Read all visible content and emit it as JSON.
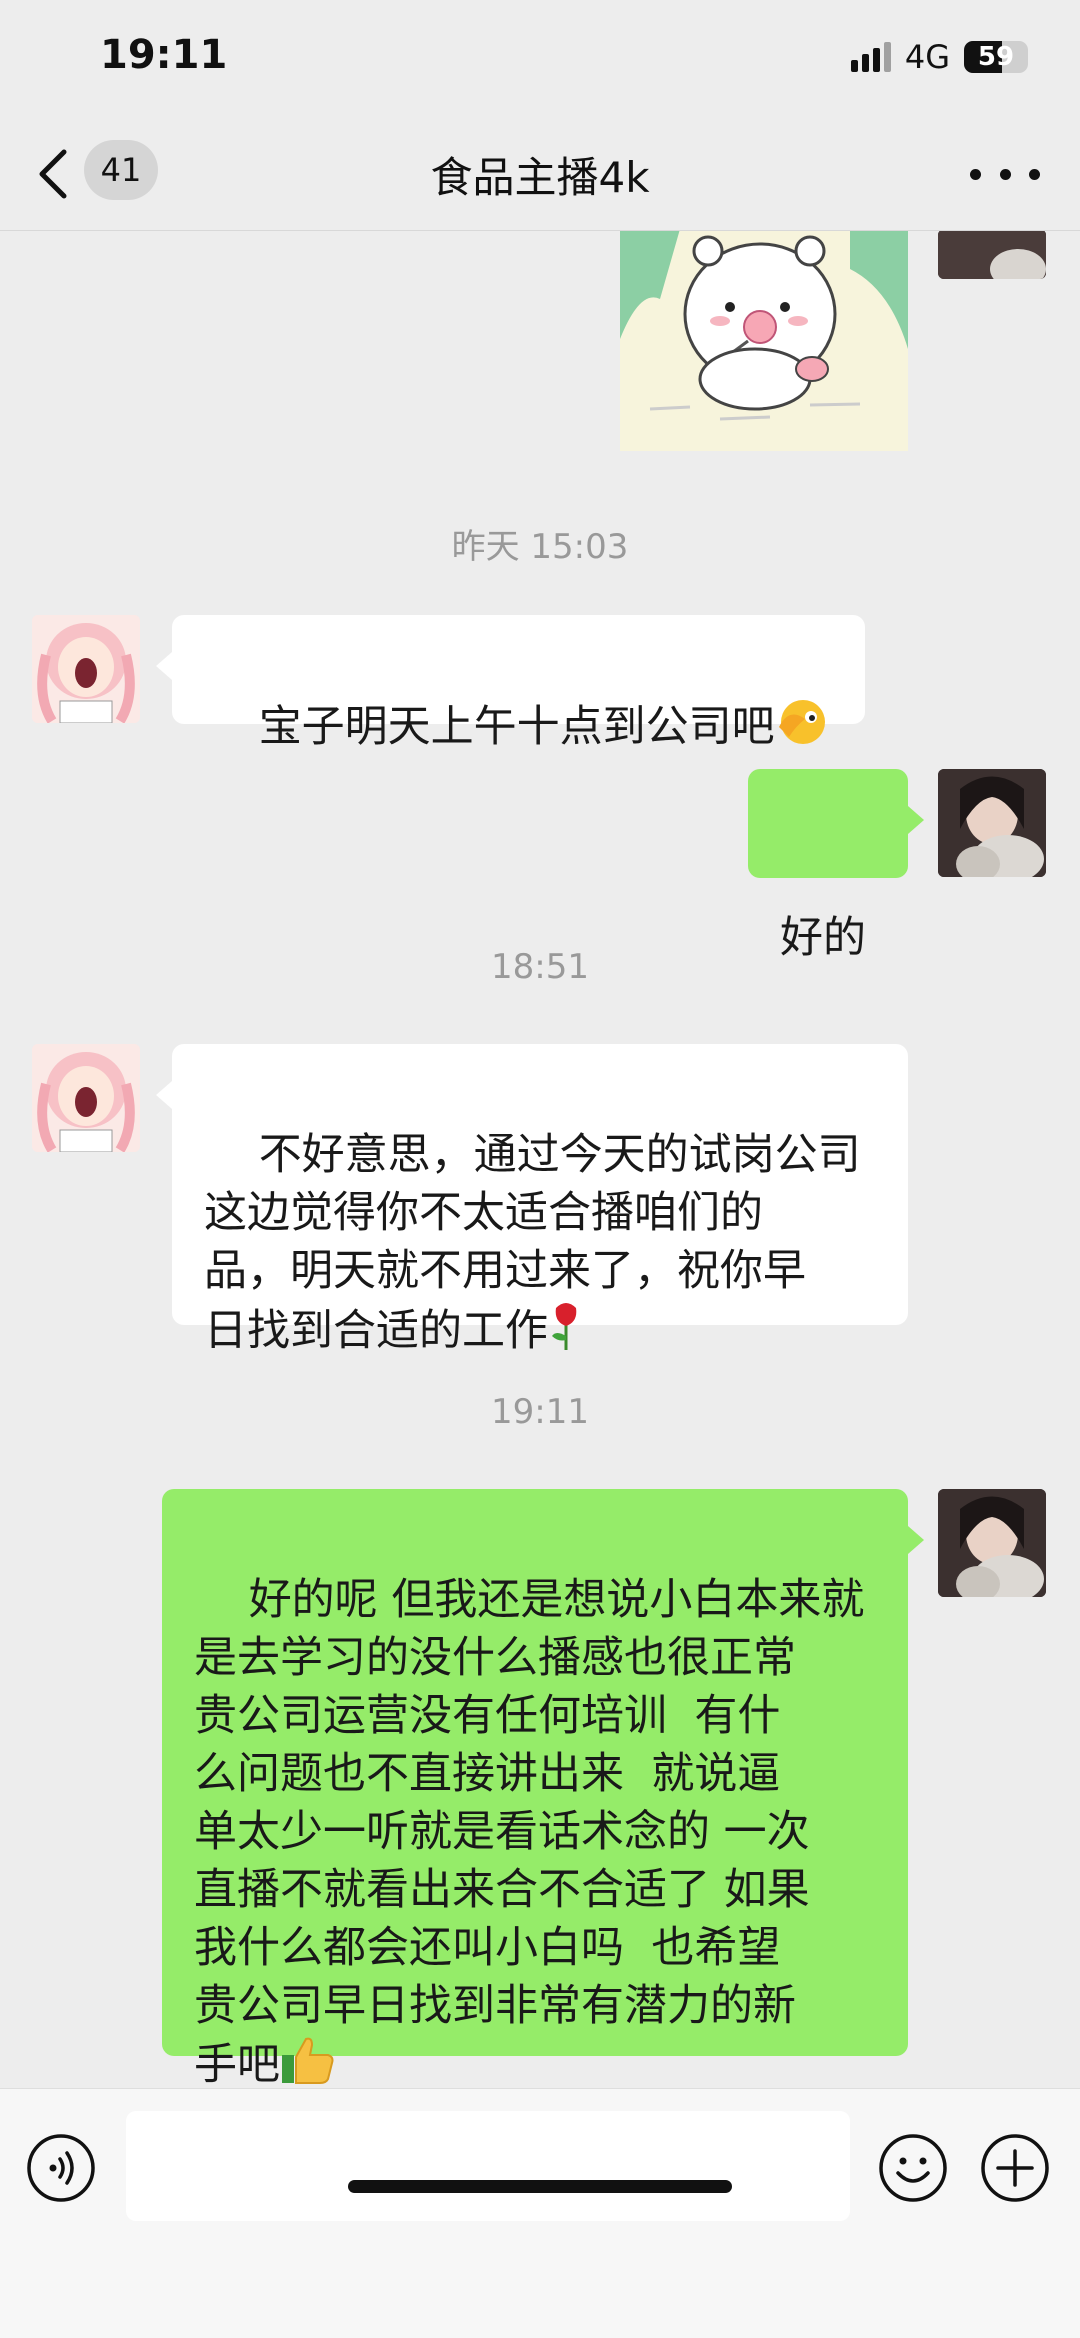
{
  "status": {
    "time": "19:11",
    "network": "4G",
    "battery": "59",
    "battery_level": 0.59
  },
  "header": {
    "unread_count": "41",
    "title": "食品主播4k"
  },
  "messages": {
    "ts1": "昨天 15:03",
    "m1": "宝子明天上午十点到公司吧",
    "m2": "好的",
    "ts2": "18:51",
    "m3": "不好意思，通过今天的试岗公司\n这边觉得你不太适合播咱们的\n品，明天就不用过来了，祝你早\n日找到合适的工作",
    "ts3": "19:11",
    "m4": "好的呢 但我还是想说小白本来就\n是去学习的没什么播感也很正常\n贵公司运营没有任何培训  有什\n么问题也不直接讲出来  就说逼\n单太少一听就是看话术念的 一次\n直播不就看出来合不合适了 如果\n我什么都会还叫小白吗  也希望\n贵公司早日找到非常有潜力的新\n手吧"
  },
  "emojis": {
    "m1": "face-with-hand-over-eye-icon",
    "m3": "rose-icon",
    "m4": "thumbs-up-icon"
  },
  "colors": {
    "self_bubble": "#95ec69",
    "other_bubble": "#ffffff",
    "background": "#ededed"
  }
}
